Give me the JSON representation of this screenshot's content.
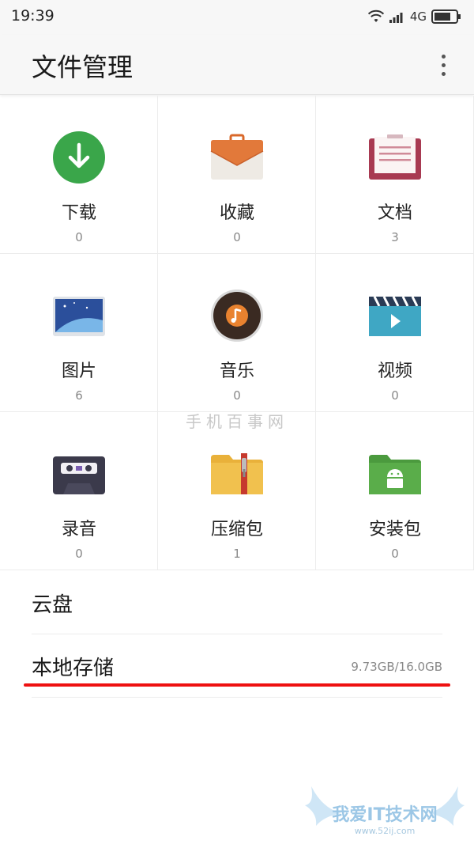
{
  "status_bar": {
    "time": "19:39",
    "network": "4G",
    "icons": [
      "wifi-icon",
      "signal-icon",
      "battery-icon"
    ]
  },
  "app_bar": {
    "title": "文件管理",
    "menu_icon": "more-vert-icon"
  },
  "categories": [
    {
      "label": "下载",
      "count": "0",
      "icon": "download-icon"
    },
    {
      "label": "收藏",
      "count": "0",
      "icon": "favorites-icon"
    },
    {
      "label": "文档",
      "count": "3",
      "icon": "document-icon"
    },
    {
      "label": "图片",
      "count": "6",
      "icon": "image-icon"
    },
    {
      "label": "音乐",
      "count": "0",
      "icon": "music-icon"
    },
    {
      "label": "视频",
      "count": "0",
      "icon": "video-icon"
    },
    {
      "label": "录音",
      "count": "0",
      "icon": "recording-icon"
    },
    {
      "label": "压缩包",
      "count": "1",
      "icon": "archive-icon"
    },
    {
      "label": "安装包",
      "count": "0",
      "icon": "apk-icon"
    }
  ],
  "list": {
    "cloud": {
      "label": "云盘"
    },
    "local": {
      "label": "本地存储",
      "usage": "9.73GB/16.0GB"
    }
  },
  "watermarks": {
    "center": "手机百事网",
    "footer": "我爱IT技术网",
    "footer_url": "www.52ij.com"
  },
  "colors": {
    "download_green": "#3aa64a",
    "highlight_red": "#ee1111",
    "apk_green": "#5aad4a",
    "archive_yellow": "#e9b13a",
    "document_red": "#a83a52"
  }
}
